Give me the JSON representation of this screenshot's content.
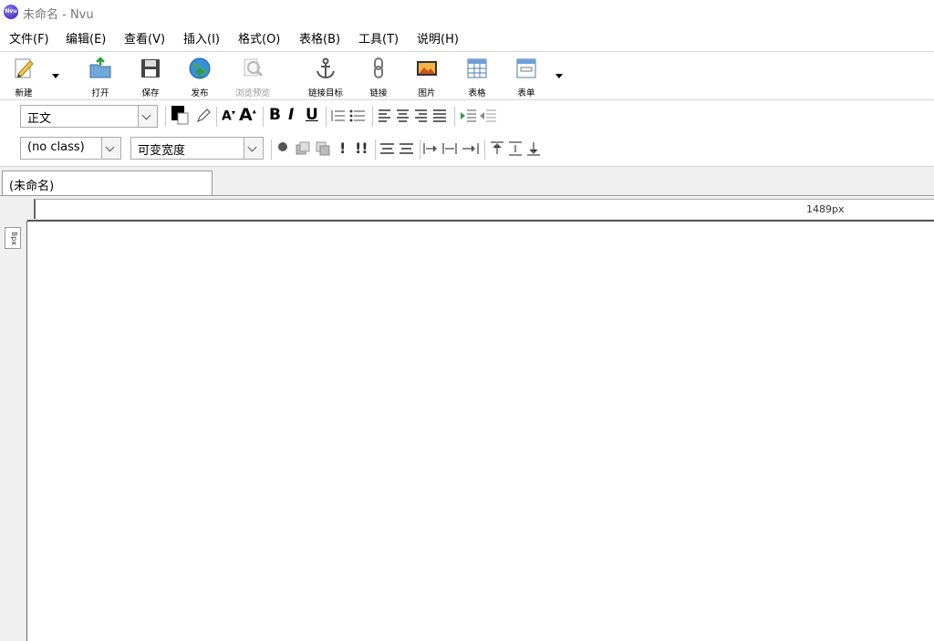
{
  "window": {
    "title": "未命名 - Nvu",
    "app_icon_text": "Nvu"
  },
  "menu": [
    {
      "label": "文件(F)"
    },
    {
      "label": "编辑(E)"
    },
    {
      "label": "查看(V)"
    },
    {
      "label": "插入(I)"
    },
    {
      "label": "格式(O)"
    },
    {
      "label": "表格(B)"
    },
    {
      "label": "工具(T)"
    },
    {
      "label": "说明(H)"
    }
  ],
  "toolbar": {
    "new": "新建",
    "open": "打开",
    "save": "保存",
    "publish": "发布",
    "preview": "浏览预览",
    "anchor": "链接目标",
    "link": "链接",
    "image": "图片",
    "table": "表格",
    "form": "表单"
  },
  "format_toolbar": {
    "paragraph_style": "正文",
    "bold": "B",
    "italic": "I",
    "underline": "U"
  },
  "style_toolbar": {
    "class_value": "(no class)",
    "width_value": "可变宽度",
    "important_single": "!",
    "important_double": "!!"
  },
  "tabs": [
    {
      "label": "(未命名)"
    }
  ],
  "ruler": {
    "width_label": "1489px",
    "height_label": "8px"
  },
  "colors": {
    "accent": "#4b36c7",
    "toolbar_bg": "#ffffff",
    "chrome": "#f0f0f0"
  }
}
